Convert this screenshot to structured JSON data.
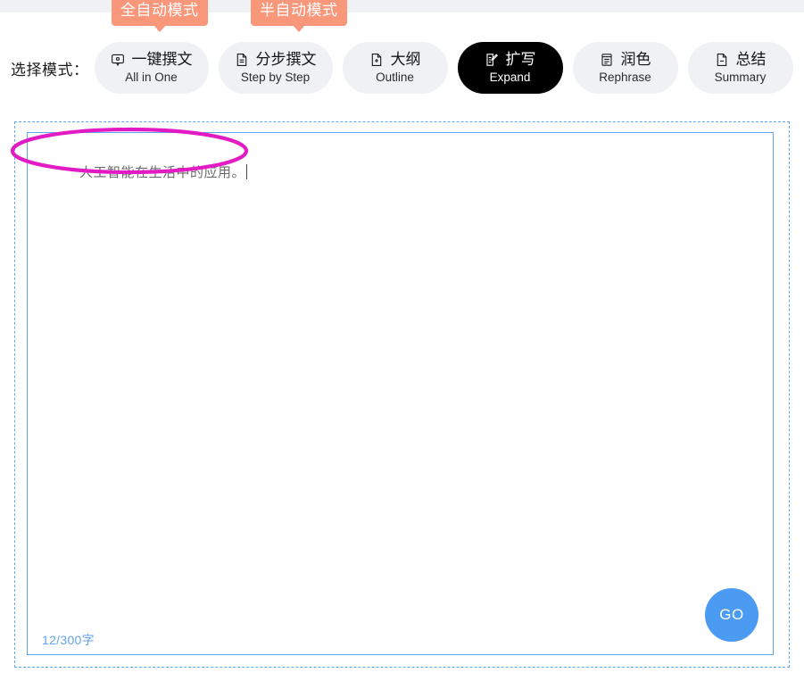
{
  "header": {
    "mode_label": "选择模式：",
    "badges": [
      {
        "id": "badge-auto",
        "text": "全自动模式",
        "color": "#f8977a"
      },
      {
        "id": "badge-semi",
        "text": "半自动模式",
        "color": "#f8977a"
      }
    ]
  },
  "modes": [
    {
      "icon": "speech-bubble-icon",
      "zh": "一键撰文",
      "en": "All in One",
      "active": false
    },
    {
      "icon": "document-icon",
      "zh": "分步撰文",
      "en": "Step by Step",
      "active": false
    },
    {
      "icon": "document-plus-icon",
      "zh": "大纲",
      "en": "Outline",
      "active": false
    },
    {
      "icon": "document-edit-icon",
      "zh": "扩写",
      "en": "Expand",
      "active": true
    },
    {
      "icon": "document-list-icon",
      "zh": "润色",
      "en": "Rephrase",
      "active": false
    },
    {
      "icon": "document-minus-icon",
      "zh": "总结",
      "en": "Summary",
      "active": false
    }
  ],
  "editor": {
    "value": "人工智能在生活中的应用。",
    "counter": "12/300字",
    "go_label": "GO",
    "accent_color": "#4a9bf1",
    "border_color": "#5ea7f0"
  },
  "annotation": {
    "shape": "ellipse",
    "color": "#e31bc4"
  }
}
